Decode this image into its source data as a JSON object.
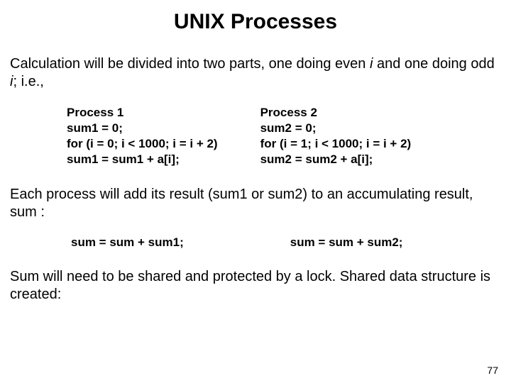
{
  "title": "UNIX Processes",
  "intro": {
    "pre_i1": "Calculation will be divided into two parts, one doing even ",
    "i1": "i",
    "mid": " and one doing odd ",
    "i2": "i",
    "post": "; i.e.,"
  },
  "code": {
    "left": "Process 1\nsum1 = 0;\nfor (i = 0; i < 1000; i = i + 2)\nsum1 = sum1 + a[i];",
    "right": "Process 2\nsum2 = 0;\nfor (i = 1; i < 1000; i = i + 2)\nsum2 = sum2 + a[i];"
  },
  "para2": "Each process will add its result (sum1 or sum2) to an accumulating result, sum :",
  "sums": {
    "left": "sum = sum + sum1;",
    "right": "sum = sum + sum2;"
  },
  "para3": "Sum will need to be shared and protected by a lock. Shared data structure is created:",
  "page": "77"
}
